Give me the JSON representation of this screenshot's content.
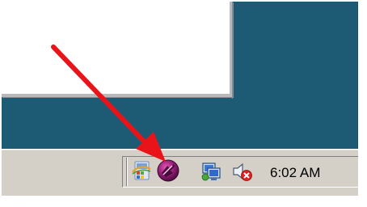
{
  "desktop": {
    "background_color": "#1d5a74"
  },
  "taskbar": {
    "background_color": "#d4d0c8",
    "tray": {
      "icons": [
        {
          "name": "quick-launch-app-icon"
        },
        {
          "name": "highlighted-app-tray-icon"
        },
        {
          "name": "network-icon"
        },
        {
          "name": "volume-muted-icon"
        }
      ],
      "clock": "6:02 AM"
    }
  },
  "annotation": {
    "arrow_color": "#e8141a"
  }
}
